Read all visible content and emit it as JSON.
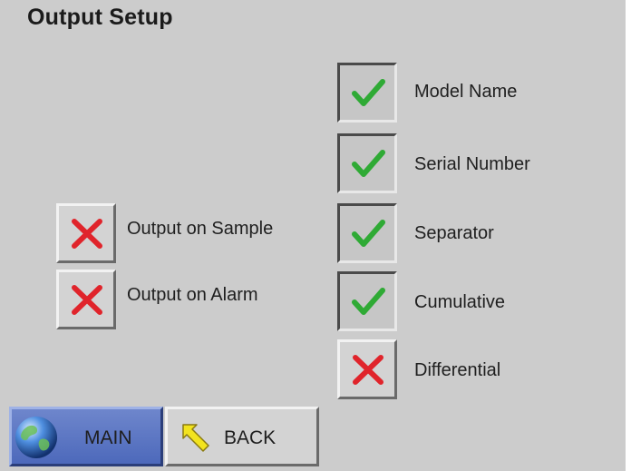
{
  "title": "Output Setup",
  "left_options": [
    {
      "label": "Output on Sample",
      "checked": false,
      "icon": "x-icon"
    },
    {
      "label": "Output on Alarm",
      "checked": false,
      "icon": "x-icon"
    }
  ],
  "right_options": [
    {
      "label": "Model Name",
      "checked": true,
      "icon": "checkmark-icon"
    },
    {
      "label": "Serial Number",
      "checked": true,
      "icon": "checkmark-icon"
    },
    {
      "label": "Separator",
      "checked": true,
      "icon": "checkmark-icon"
    },
    {
      "label": "Cumulative",
      "checked": true,
      "icon": "checkmark-icon"
    },
    {
      "label": "Differential",
      "checked": false,
      "icon": "x-icon"
    }
  ],
  "nav": {
    "main_label": "MAIN",
    "main_icon": "globe-icon",
    "back_label": "BACK",
    "back_icon": "back-arrow-icon"
  },
  "colors": {
    "background": "#cccccc",
    "check_green": "#2faa35",
    "x_red": "#e0242b",
    "main_blue": "#5a74c4",
    "arrow_yellow": "#f2e31e"
  }
}
